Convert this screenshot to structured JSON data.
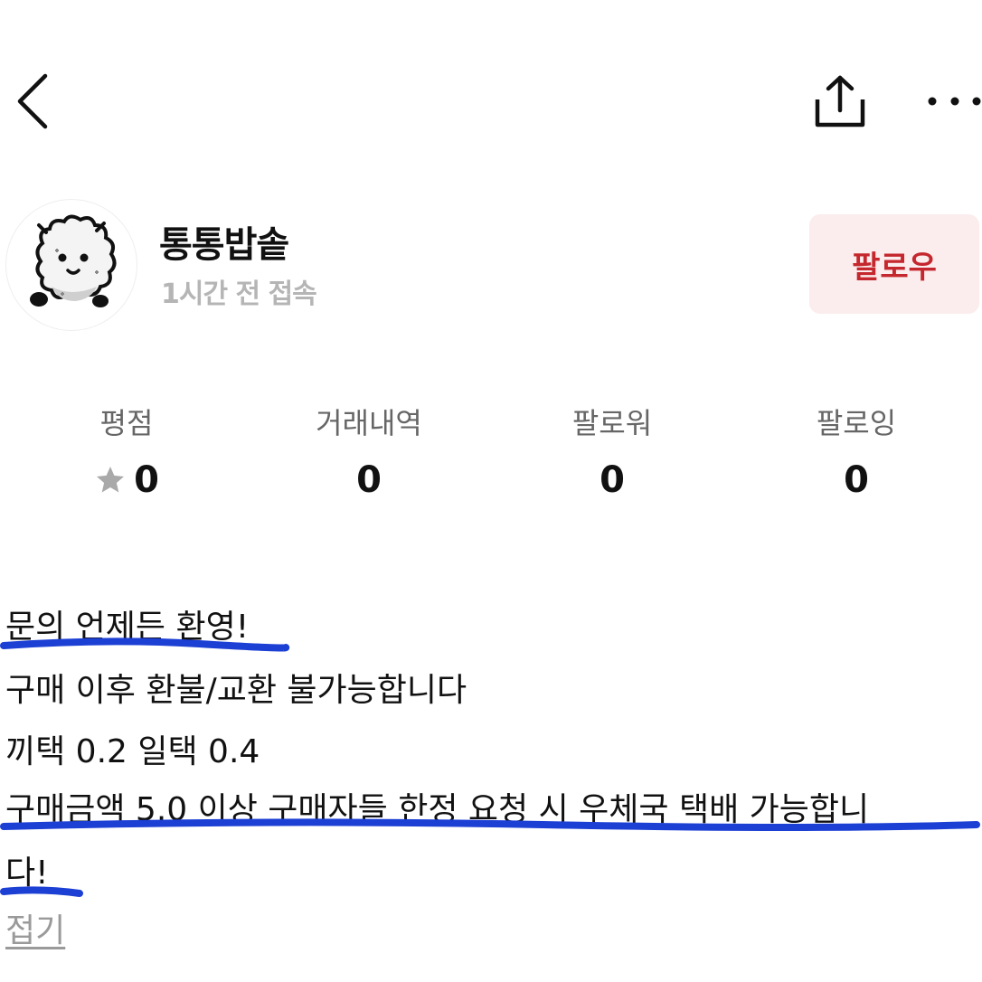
{
  "header": {
    "back_icon": "chevron-left-icon",
    "share_icon": "share-icon",
    "more_icon": "more-horizontal-icon"
  },
  "profile": {
    "avatar_icon": "fluffy-character-avatar",
    "name": "통통밥솥",
    "last_seen": "1시간 전 접속",
    "follow_label": "팔로우"
  },
  "stats": [
    {
      "label": "평점",
      "value": "0",
      "icon": "star-icon"
    },
    {
      "label": "거래내역",
      "value": "0"
    },
    {
      "label": "팔로워",
      "value": "0"
    },
    {
      "label": "팔로잉",
      "value": "0"
    }
  ],
  "intro": {
    "lines": [
      "문의 언제든 환영!",
      "구매 이후 환불/교환 불가능합니다",
      "끼택 0.2 일택 0.4",
      "구매금액 5.0 이상 구매자들 한정 요청 시 우체국 택배 가능합니",
      "다!"
    ],
    "collapse_label": "접기"
  },
  "colors": {
    "follow_text": "#c4272d",
    "follow_bg": "#fbeced",
    "highlight_pen": "#1c3fd4",
    "muted_text": "#b5b5b5"
  }
}
